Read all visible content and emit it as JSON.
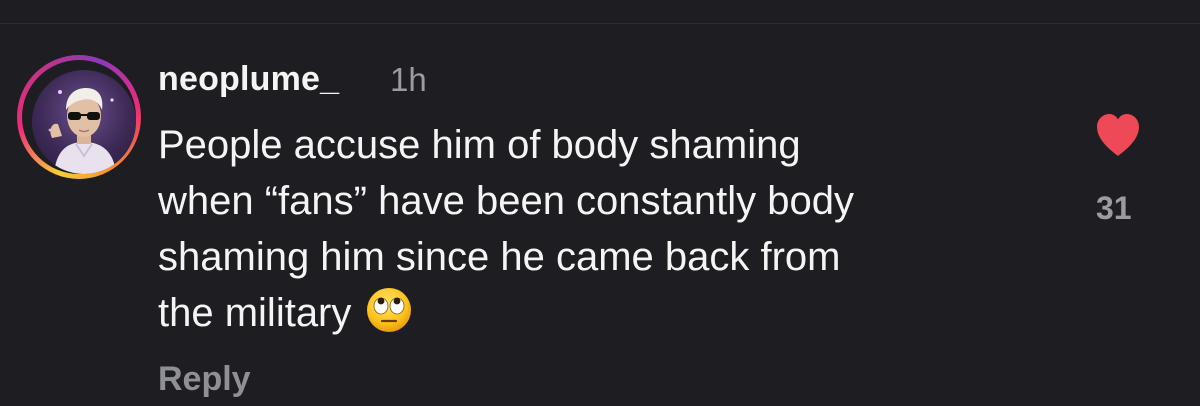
{
  "comment": {
    "username": "neoplume_",
    "timestamp": "1h",
    "lines": [
      "People accuse him of body shaming",
      "when “fans” have been constantly body",
      "shaming him since he came back from",
      "the military"
    ],
    "emoji": "face-with-rolling-eyes",
    "reply_label": "Reply",
    "likes": "31",
    "liked": true
  },
  "colors": {
    "background": "#1e1e22",
    "like_heart": "#ed4956",
    "muted_text": "#9b9ba1"
  },
  "icons": {
    "like": "heart-icon",
    "avatar": "profile-photo"
  }
}
